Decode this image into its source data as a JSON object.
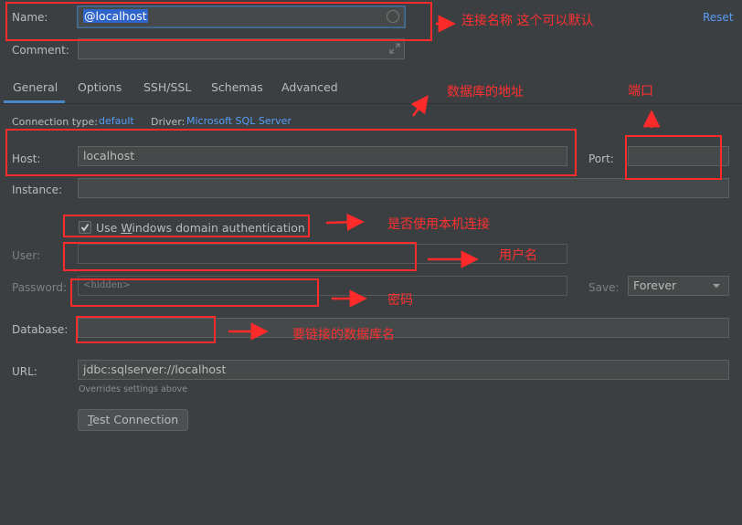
{
  "form": {
    "name_label": "Name:",
    "name_value": "@localhost",
    "comment_label": "Comment:",
    "reset_label": "Reset",
    "tabs": [
      {
        "label": "General"
      },
      {
        "label": "Options"
      },
      {
        "label": "SSH/SSL"
      },
      {
        "label": "Schemas"
      },
      {
        "label": "Advanced"
      }
    ],
    "connection_type_label": "Connection type:",
    "connection_type_value": "default",
    "driver_label": "Driver:",
    "driver_value": "Microsoft SQL Server",
    "host_label": "Host:",
    "host_value": "localhost",
    "port_label": "Port:",
    "port_value": "",
    "instance_label": "Instance:",
    "windows_auth_prefix": "Use ",
    "windows_auth_mnemonic": "W",
    "windows_auth_suffix": "indows domain authentication",
    "user_label": "User:",
    "password_label": "Password:",
    "password_placeholder": "<hidden>",
    "save_label": "Save:",
    "save_value": "Forever",
    "database_label": "Database:",
    "url_label": "URL:",
    "url_value": "jdbc:sqlserver://localhost",
    "url_hint": "Overrides settings above",
    "test_connection_mnemonic": "T",
    "test_connection_suffix": "est Connection"
  },
  "annotations": {
    "name_note": "连接名称 这个可以默认",
    "host_note": "数据库的地址",
    "port_note": "端口",
    "windows_auth_note": "是否使用本机连接",
    "user_note": "用户名",
    "password_note": "密码",
    "database_note": "要链接的数据库名"
  },
  "colors": {
    "background": "#3c3f41",
    "accent": "#4a88c7",
    "link": "#589df6",
    "annotation": "#ff2a2a"
  }
}
